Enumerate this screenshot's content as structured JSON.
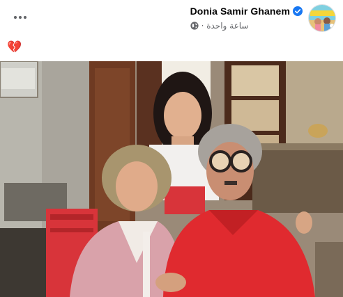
{
  "post": {
    "author_name": "Donia Samir Ghanem",
    "timestamp": "ساعة واحدة ·",
    "caption": "💔",
    "verified_color": "#1877f2",
    "meta_color": "#65676b"
  },
  "icons": {
    "more": "more-dots-icon",
    "verified": "verified-badge-icon",
    "audience": "globe-icon"
  }
}
